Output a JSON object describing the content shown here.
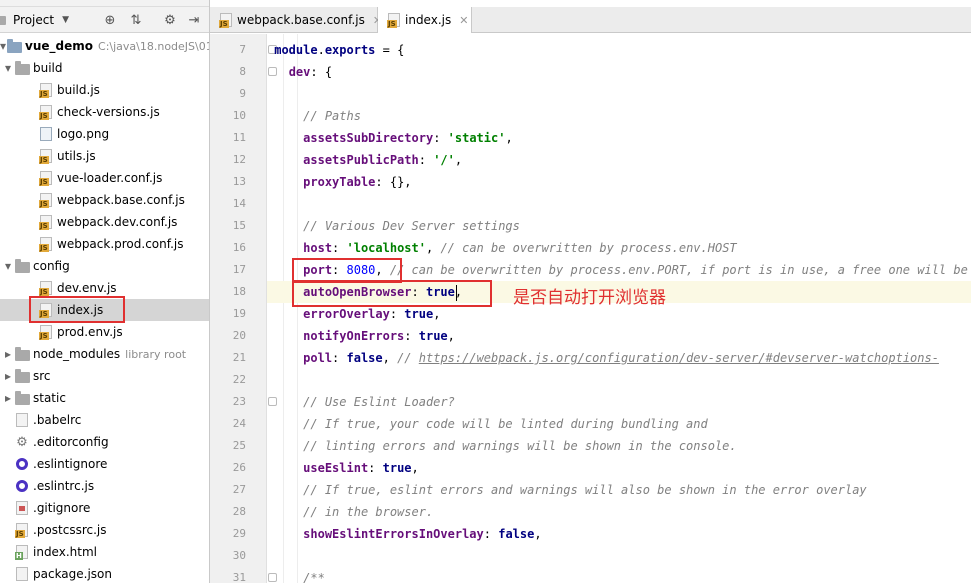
{
  "project_panel": {
    "title": "Project",
    "tree": [
      {
        "label": "vue_demo",
        "extra": "C:\\java\\18.nodeJS\\01.s",
        "kind": "root",
        "depth": 0,
        "arrow": "down"
      },
      {
        "label": "build",
        "kind": "folder",
        "depth": 1,
        "arrow": "down"
      },
      {
        "label": "build.js",
        "kind": "js",
        "depth": 2
      },
      {
        "label": "check-versions.js",
        "kind": "js",
        "depth": 2
      },
      {
        "label": "logo.png",
        "kind": "img",
        "depth": 2
      },
      {
        "label": "utils.js",
        "kind": "js",
        "depth": 2
      },
      {
        "label": "vue-loader.conf.js",
        "kind": "js",
        "depth": 2
      },
      {
        "label": "webpack.base.conf.js",
        "kind": "js",
        "depth": 2
      },
      {
        "label": "webpack.dev.conf.js",
        "kind": "js",
        "depth": 2
      },
      {
        "label": "webpack.prod.conf.js",
        "kind": "js",
        "depth": 2
      },
      {
        "label": "config",
        "kind": "folder",
        "depth": 1,
        "arrow": "down"
      },
      {
        "label": "dev.env.js",
        "kind": "js",
        "depth": 2
      },
      {
        "label": "index.js",
        "kind": "js",
        "depth": 2,
        "selected": true
      },
      {
        "label": "prod.env.js",
        "kind": "js",
        "depth": 2
      },
      {
        "label": "node_modules",
        "extra": "library root",
        "kind": "folder",
        "depth": 1,
        "arrow": "right"
      },
      {
        "label": "src",
        "kind": "folder",
        "depth": 1,
        "arrow": "right"
      },
      {
        "label": "static",
        "kind": "folder",
        "depth": 1,
        "arrow": "right"
      },
      {
        "label": ".babelrc",
        "kind": "cfg",
        "depth": 1
      },
      {
        "label": ".editorconfig",
        "kind": "gear",
        "depth": 1
      },
      {
        "label": ".eslintignore",
        "kind": "eslint",
        "depth": 1
      },
      {
        "label": ".eslintrc.js",
        "kind": "eslint",
        "depth": 1
      },
      {
        "label": ".gitignore",
        "kind": "git",
        "depth": 1
      },
      {
        "label": ".postcssrc.js",
        "kind": "js",
        "depth": 1
      },
      {
        "label": "index.html",
        "kind": "html",
        "depth": 1
      },
      {
        "label": "package.json",
        "kind": "cfg",
        "depth": 1
      }
    ]
  },
  "tabs": [
    {
      "label": "webpack.base.conf.js",
      "active": false
    },
    {
      "label": "index.js",
      "active": true
    }
  ],
  "editor": {
    "current_line": 18,
    "lines": [
      {
        "n": 7,
        "tokens": [
          [
            "kw",
            "module"
          ],
          [
            "",
            "."
          ],
          [
            "kw",
            "exports"
          ],
          [
            "",
            " = {"
          ]
        ]
      },
      {
        "n": 8,
        "tokens": [
          [
            "",
            "  "
          ],
          [
            "prop",
            "dev"
          ],
          [
            "",
            ": {"
          ]
        ]
      },
      {
        "n": 9,
        "tokens": []
      },
      {
        "n": 10,
        "tokens": [
          [
            "",
            "    "
          ],
          [
            "cm",
            "// Paths"
          ]
        ]
      },
      {
        "n": 11,
        "tokens": [
          [
            "",
            "    "
          ],
          [
            "prop",
            "assetsSubDirectory"
          ],
          [
            "",
            ": "
          ],
          [
            "str",
            "'static'"
          ],
          [
            "",
            ","
          ]
        ]
      },
      {
        "n": 12,
        "tokens": [
          [
            "",
            "    "
          ],
          [
            "prop",
            "assetsPublicPath"
          ],
          [
            "",
            ": "
          ],
          [
            "str",
            "'/'"
          ],
          [
            "",
            ","
          ]
        ]
      },
      {
        "n": 13,
        "tokens": [
          [
            "",
            "    "
          ],
          [
            "prop",
            "proxyTable"
          ],
          [
            "",
            ": {},"
          ]
        ]
      },
      {
        "n": 14,
        "tokens": []
      },
      {
        "n": 15,
        "tokens": [
          [
            "",
            "    "
          ],
          [
            "cm",
            "// Various Dev Server settings"
          ]
        ]
      },
      {
        "n": 16,
        "tokens": [
          [
            "",
            "    "
          ],
          [
            "prop",
            "host"
          ],
          [
            "",
            ": "
          ],
          [
            "str",
            "'localhost'"
          ],
          [
            "",
            ", "
          ],
          [
            "cm",
            "// can be overwritten by process.env.HOST"
          ]
        ]
      },
      {
        "n": 17,
        "tokens": [
          [
            "",
            "    "
          ],
          [
            "prop",
            "port"
          ],
          [
            "",
            ": "
          ],
          [
            "num",
            "8080"
          ],
          [
            "",
            ", "
          ],
          [
            "cm",
            "// can be overwritten by process.env.PORT, if port is in use, a free one will be de"
          ]
        ]
      },
      {
        "n": 18,
        "tokens": [
          [
            "",
            "    "
          ],
          [
            "prop",
            "autoOpenBrowser"
          ],
          [
            "",
            ": "
          ],
          [
            "kw",
            "true"
          ],
          [
            "",
            ","
          ]
        ]
      },
      {
        "n": 19,
        "tokens": [
          [
            "",
            "    "
          ],
          [
            "prop",
            "errorOverlay"
          ],
          [
            "",
            ": "
          ],
          [
            "kw",
            "true"
          ],
          [
            "",
            ","
          ]
        ]
      },
      {
        "n": 20,
        "tokens": [
          [
            "",
            "    "
          ],
          [
            "prop",
            "notifyOnErrors"
          ],
          [
            "",
            ": "
          ],
          [
            "kw",
            "true"
          ],
          [
            "",
            ","
          ]
        ]
      },
      {
        "n": 21,
        "tokens": [
          [
            "",
            "    "
          ],
          [
            "prop",
            "poll"
          ],
          [
            "",
            ": "
          ],
          [
            "kw",
            "false"
          ],
          [
            "",
            ", "
          ],
          [
            "cm",
            "// "
          ],
          [
            "link",
            "https://webpack.js.org/configuration/dev-server/#devserver-watchoptions-"
          ]
        ]
      },
      {
        "n": 22,
        "tokens": []
      },
      {
        "n": 23,
        "tokens": [
          [
            "",
            "    "
          ],
          [
            "cm",
            "// Use Eslint Loader?"
          ]
        ]
      },
      {
        "n": 24,
        "tokens": [
          [
            "",
            "    "
          ],
          [
            "cm",
            "// If true, your code will be linted during bundling and"
          ]
        ]
      },
      {
        "n": 25,
        "tokens": [
          [
            "",
            "    "
          ],
          [
            "cm",
            "// linting errors and warnings will be shown in the console."
          ]
        ]
      },
      {
        "n": 26,
        "tokens": [
          [
            "",
            "    "
          ],
          [
            "prop",
            "useEslint"
          ],
          [
            "",
            ": "
          ],
          [
            "kw",
            "true"
          ],
          [
            "",
            ","
          ]
        ]
      },
      {
        "n": 27,
        "tokens": [
          [
            "",
            "    "
          ],
          [
            "cm",
            "// If true, eslint errors and warnings will also be shown in the error overlay"
          ]
        ]
      },
      {
        "n": 28,
        "tokens": [
          [
            "",
            "    "
          ],
          [
            "cm",
            "// in the browser."
          ]
        ]
      },
      {
        "n": 29,
        "tokens": [
          [
            "",
            "    "
          ],
          [
            "prop",
            "showEslintErrorsInOverlay"
          ],
          [
            "",
            ": "
          ],
          [
            "kw",
            "false"
          ],
          [
            "",
            ","
          ]
        ]
      },
      {
        "n": 30,
        "tokens": []
      },
      {
        "n": 31,
        "tokens": [
          [
            "",
            "    "
          ],
          [
            "cm",
            "/**"
          ]
        ]
      }
    ]
  },
  "annotation": {
    "text": "是否自动打开浏览器",
    "color": "#e03030"
  },
  "colors": {
    "highlight": "#e03030",
    "selection": "#d5d5d5",
    "current_line": "#fbf9e4"
  }
}
